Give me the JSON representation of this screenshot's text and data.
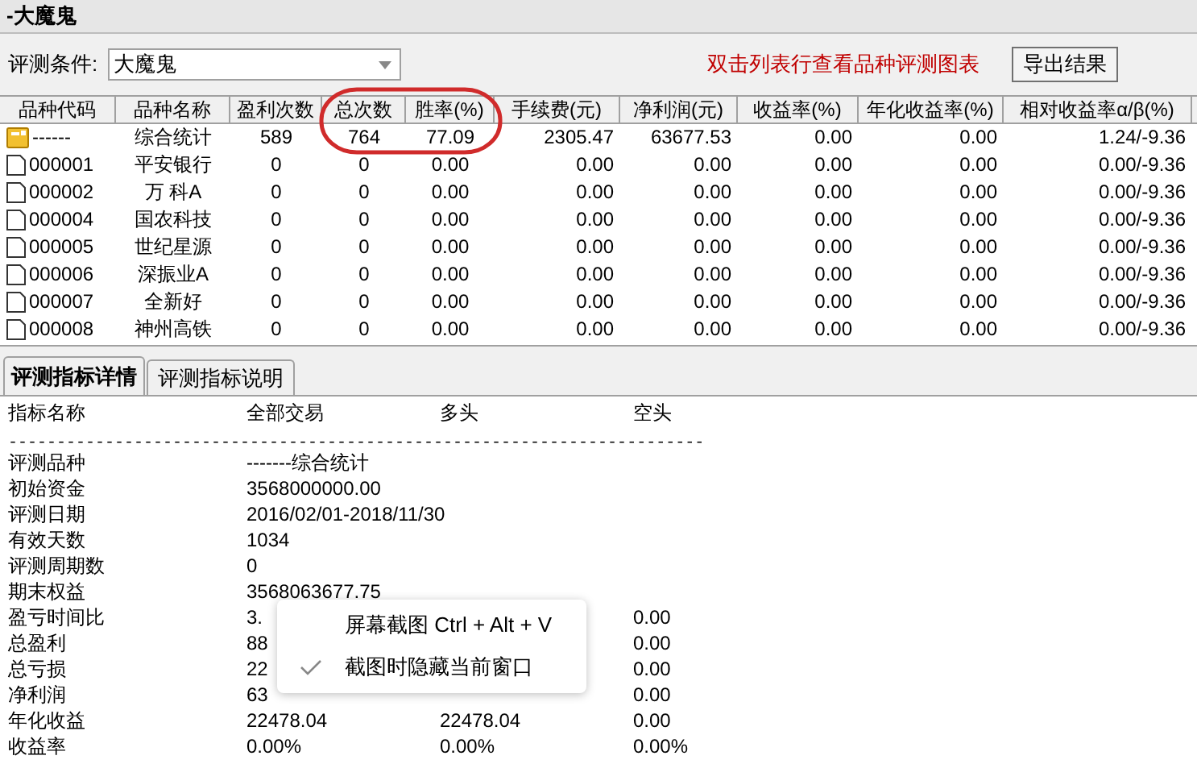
{
  "window": {
    "title": "-大魔鬼"
  },
  "toolbar": {
    "condition_label": "评测条件:",
    "condition_value": "大魔鬼",
    "hint": "双击列表行查看品种评测图表",
    "export_button": "导出结果"
  },
  "table": {
    "columns": [
      "品种代码",
      "品种名称",
      "盈利次数",
      "总次数",
      "胜率(%)",
      "手续费(元)",
      "净利润(元)",
      "收益率(%)",
      "年化收益率(%)",
      "相对收益率α/β(%)"
    ],
    "rows": [
      {
        "kind": "summary",
        "cells": [
          "------",
          "综合统计",
          "589",
          "764",
          "77.09",
          "2305.47",
          "63677.53",
          "0.00",
          "0.00",
          "1.24/-9.36"
        ]
      },
      {
        "kind": "stock",
        "cells": [
          "000001",
          "平安银行",
          "0",
          "0",
          "0.00",
          "0.00",
          "0.00",
          "0.00",
          "0.00",
          "0.00/-9.36"
        ]
      },
      {
        "kind": "stock",
        "cells": [
          "000002",
          "万 科A",
          "0",
          "0",
          "0.00",
          "0.00",
          "0.00",
          "0.00",
          "0.00",
          "0.00/-9.36"
        ]
      },
      {
        "kind": "stock",
        "cells": [
          "000004",
          "国农科技",
          "0",
          "0",
          "0.00",
          "0.00",
          "0.00",
          "0.00",
          "0.00",
          "0.00/-9.36"
        ]
      },
      {
        "kind": "stock",
        "cells": [
          "000005",
          "世纪星源",
          "0",
          "0",
          "0.00",
          "0.00",
          "0.00",
          "0.00",
          "0.00",
          "0.00/-9.36"
        ]
      },
      {
        "kind": "stock",
        "cells": [
          "000006",
          "深振业A",
          "0",
          "0",
          "0.00",
          "0.00",
          "0.00",
          "0.00",
          "0.00",
          "0.00/-9.36"
        ]
      },
      {
        "kind": "stock",
        "cells": [
          "000007",
          "全新好",
          "0",
          "0",
          "0.00",
          "0.00",
          "0.00",
          "0.00",
          "0.00",
          "0.00/-9.36"
        ]
      },
      {
        "kind": "stock",
        "cells": [
          "000008",
          "神州高铁",
          "0",
          "0",
          "0.00",
          "0.00",
          "0.00",
          "0.00",
          "0.00",
          "0.00/-9.36"
        ]
      }
    ]
  },
  "tabs": [
    {
      "label": "评测指标详情",
      "selected": true
    },
    {
      "label": "评测指标说明",
      "selected": false
    }
  ],
  "details": {
    "columns": [
      "指标名称",
      "全部交易",
      "多头",
      "空头"
    ],
    "separator": "------------------------------------------------------------------------",
    "rows": [
      {
        "name": "评测品种",
        "all": "-------综合统计"
      },
      {
        "name": "初始资金",
        "all": "3568000000.00"
      },
      {
        "name": "评测日期",
        "all": "2016/02/01-2018/11/30"
      },
      {
        "name": "有效天数",
        "all": "1034"
      },
      {
        "name": "评测周期数",
        "all": "0"
      },
      {
        "name": "期末权益",
        "all": "3568063677.75"
      },
      {
        "name": "盈亏时间比",
        "all": "3.",
        "short": "0.00"
      },
      {
        "name": "总盈利",
        "all": "88",
        "short": "0.00"
      },
      {
        "name": "总亏损",
        "all": "22",
        "short": "0.00"
      },
      {
        "name": "净利润",
        "all": "63",
        "short": "0.00"
      },
      {
        "name": "年化收益",
        "all": "22478.04",
        "long": "22478.04",
        "short": "0.00"
      },
      {
        "name": "收益率",
        "all": "0.00%",
        "long": "0.00%",
        "short": "0.00%"
      }
    ]
  },
  "context_menu": {
    "items": [
      {
        "label": "屏幕截图 Ctrl + Alt + V",
        "checked": false
      },
      {
        "label": "截图时隐藏当前窗口",
        "checked": true
      }
    ]
  }
}
